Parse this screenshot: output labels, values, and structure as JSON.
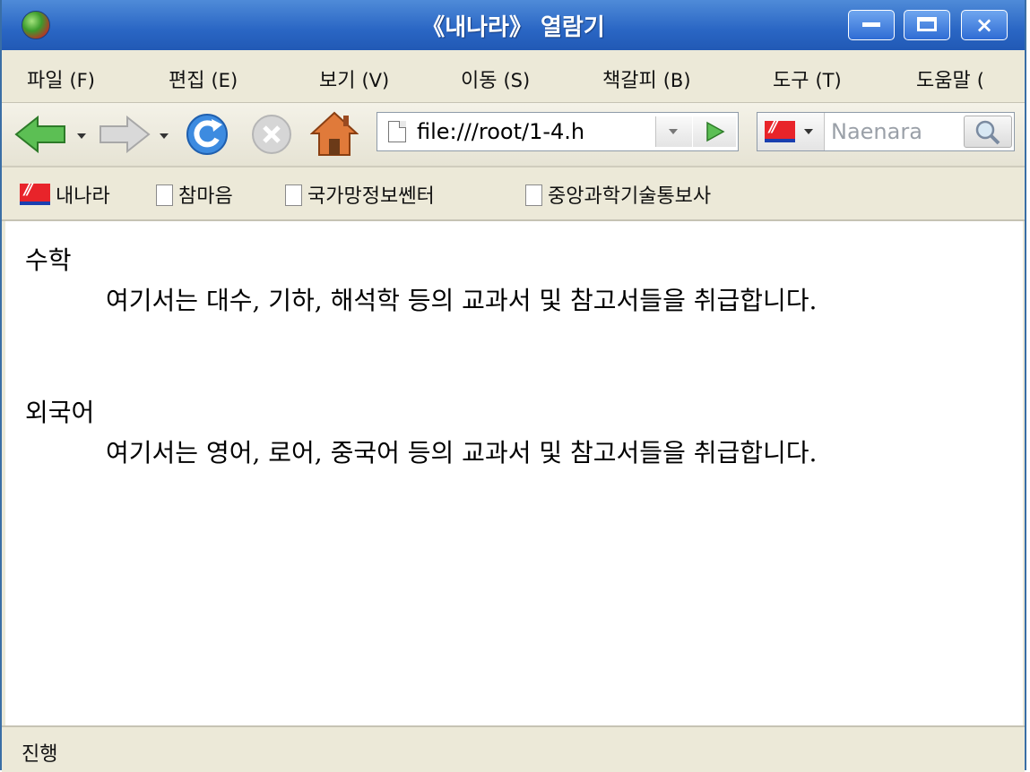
{
  "window": {
    "title": "《내나라》 열람기"
  },
  "menubar": {
    "items": [
      {
        "label": "파일",
        "key": "(F)"
      },
      {
        "label": "편집",
        "key": "(E)"
      },
      {
        "label": "보기",
        "key": "(V)"
      },
      {
        "label": "이동",
        "key": "(S)"
      },
      {
        "label": "책갈피",
        "key": "(B)"
      },
      {
        "label": "도구",
        "key": "(T)"
      },
      {
        "label": "도움말",
        "key": "("
      }
    ]
  },
  "navbar": {
    "url": "file:///root/1-4.h",
    "search_placeholder": "Naenara"
  },
  "bookmarks": {
    "items": [
      {
        "label": "내나라",
        "icon": "naenara-logo"
      },
      {
        "label": "참마음",
        "icon": "page-icon"
      },
      {
        "label": "국가망정보쎈터",
        "icon": "page-icon"
      },
      {
        "label": "중앙과학기술통보사",
        "icon": "page-icon"
      }
    ]
  },
  "content": {
    "sections": [
      {
        "term": "수학",
        "description": "여기서는 대수, 기하, 해석학 등의 교과서 및 참고서들을 취급합니다."
      },
      {
        "term": "외국어",
        "description": "여기서는 영어, 로어, 중국어 등의 교과서 및 참고서들을 취급합니다."
      }
    ]
  },
  "statusbar": {
    "text": "진행"
  },
  "colors": {
    "titlebar": "#2a66c4",
    "chrome": "#ece9d8",
    "back_arrow": "#4db34a",
    "reload": "#2f7fd9"
  }
}
